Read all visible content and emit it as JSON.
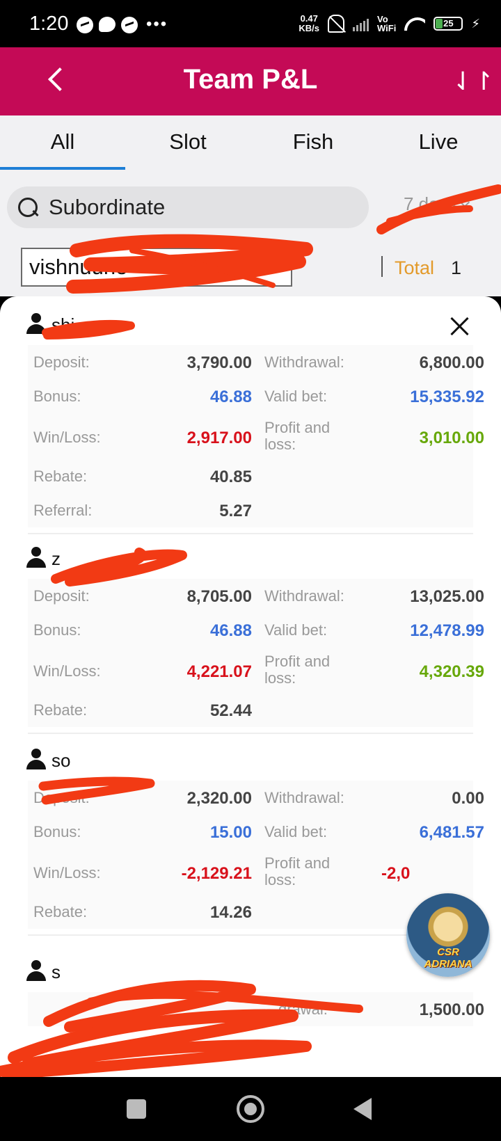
{
  "status_bar": {
    "time": "1:20",
    "net_speed_value": "0.47",
    "net_speed_unit": "KB/s",
    "network_label_top": "Vo",
    "network_label_bottom": "WiFi",
    "battery_level": "25",
    "more_dots": "•••"
  },
  "header": {
    "title": "Team P&L",
    "sort_glyph": "⇃↾"
  },
  "tabs": [
    {
      "label": "All",
      "active": true
    },
    {
      "label": "Slot",
      "active": false
    },
    {
      "label": "Fish",
      "active": false
    },
    {
      "label": "Live",
      "active": false
    }
  ],
  "search": {
    "placeholder": "Subordinate",
    "period": "7 days"
  },
  "filter": {
    "username_value": "vishnuune",
    "total_label": "Total",
    "total_value": "1"
  },
  "labels": {
    "deposit": "Deposit:",
    "withdrawal": "Withdrawal:",
    "bonus": "Bonus:",
    "valid_bet": "Valid bet:",
    "win_loss": "Win/Loss:",
    "profit_loss_1": "Profit and",
    "profit_loss_2": "loss:",
    "rebate": "Rebate:",
    "referral": "Referral:"
  },
  "members": [
    {
      "name": "shi",
      "deposit": "3,790.00",
      "withdrawal": "6,800.00",
      "bonus": "46.88",
      "valid_bet": "15,335.92",
      "win_loss": "2,917.00",
      "profit_loss": "3,010.00",
      "rebate": "40.85",
      "referral": "5.27"
    },
    {
      "name": "z",
      "deposit": "8,705.00",
      "withdrawal": "13,025.00",
      "bonus": "46.88",
      "valid_bet": "12,478.99",
      "win_loss": "4,221.07",
      "profit_loss": "4,320.39",
      "rebate": "52.44"
    },
    {
      "name": "so",
      "deposit": "2,320.00",
      "withdrawal": "0.00",
      "bonus": "15.00",
      "valid_bet": "6,481.57",
      "win_loss": "-2,129.21",
      "profit_loss": "-2,0",
      "rebate": "14.26"
    },
    {
      "name": "s",
      "withdrawal_partial": "drawal:",
      "withdrawal": "1,500.00"
    }
  ],
  "avatar": {
    "text_top": "CSR",
    "text_bottom": "ADRIANA"
  },
  "colors": {
    "header": "#c40a56",
    "tab_indicator": "#1e7fd6",
    "total_label": "#e39a2a",
    "value_blue": "#3a6fd8",
    "value_red": "#d8111b",
    "value_green": "#67a80a",
    "scribble": "#f23a14"
  },
  "icons": {
    "back": "chevron-left-icon",
    "sort": "sort-arrows-icon",
    "search": "search-icon",
    "close": "close-icon",
    "member": "person-icon"
  }
}
